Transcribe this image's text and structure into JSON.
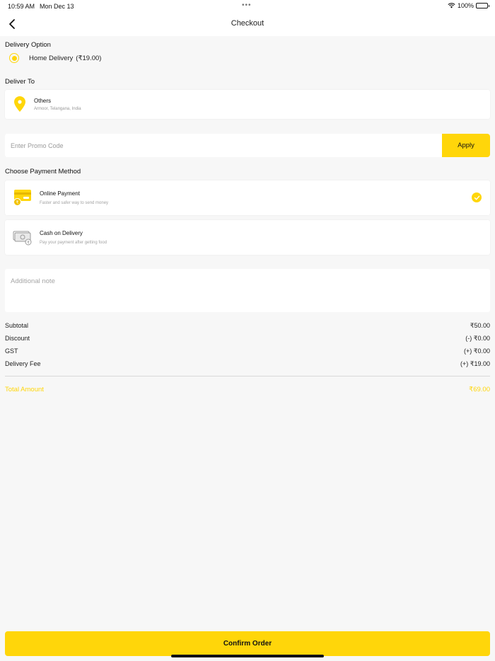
{
  "status_bar": {
    "time": "10:59 AM",
    "date": "Mon Dec 13",
    "battery": "100%"
  },
  "header": {
    "title": "Checkout"
  },
  "delivery_option": {
    "label": "Delivery Option",
    "option_label": "Home Delivery",
    "option_price": "(₹19.00)"
  },
  "deliver_to": {
    "label": "Deliver To",
    "title": "Others",
    "address": "Armoor, Telangana, India"
  },
  "promo": {
    "placeholder": "Enter Promo Code",
    "apply_label": "Apply"
  },
  "payment": {
    "label": "Choose Payment Method",
    "methods": [
      {
        "title": "Online Payment",
        "subtitle": "Faster and safer way to send money",
        "selected": true
      },
      {
        "title": "Cash on Delivery",
        "subtitle": "Pay your payment after getting food",
        "selected": false
      }
    ]
  },
  "note": {
    "placeholder": "Additional note"
  },
  "summary": {
    "subtotal_label": "Subtotal",
    "subtotal_value": "₹50.00",
    "discount_label": "Discount",
    "discount_value": "(-) ₹0.00",
    "gst_label": "GST",
    "gst_value": "(+) ₹0.00",
    "delivery_fee_label": "Delivery Fee",
    "delivery_fee_value": "(+) ₹19.00",
    "total_label": "Total Amount",
    "total_value": "₹69.00"
  },
  "footer": {
    "confirm_label": "Confirm Order"
  },
  "colors": {
    "accent": "#ffd60a",
    "background": "#f7f7f7",
    "card": "#ffffff"
  }
}
